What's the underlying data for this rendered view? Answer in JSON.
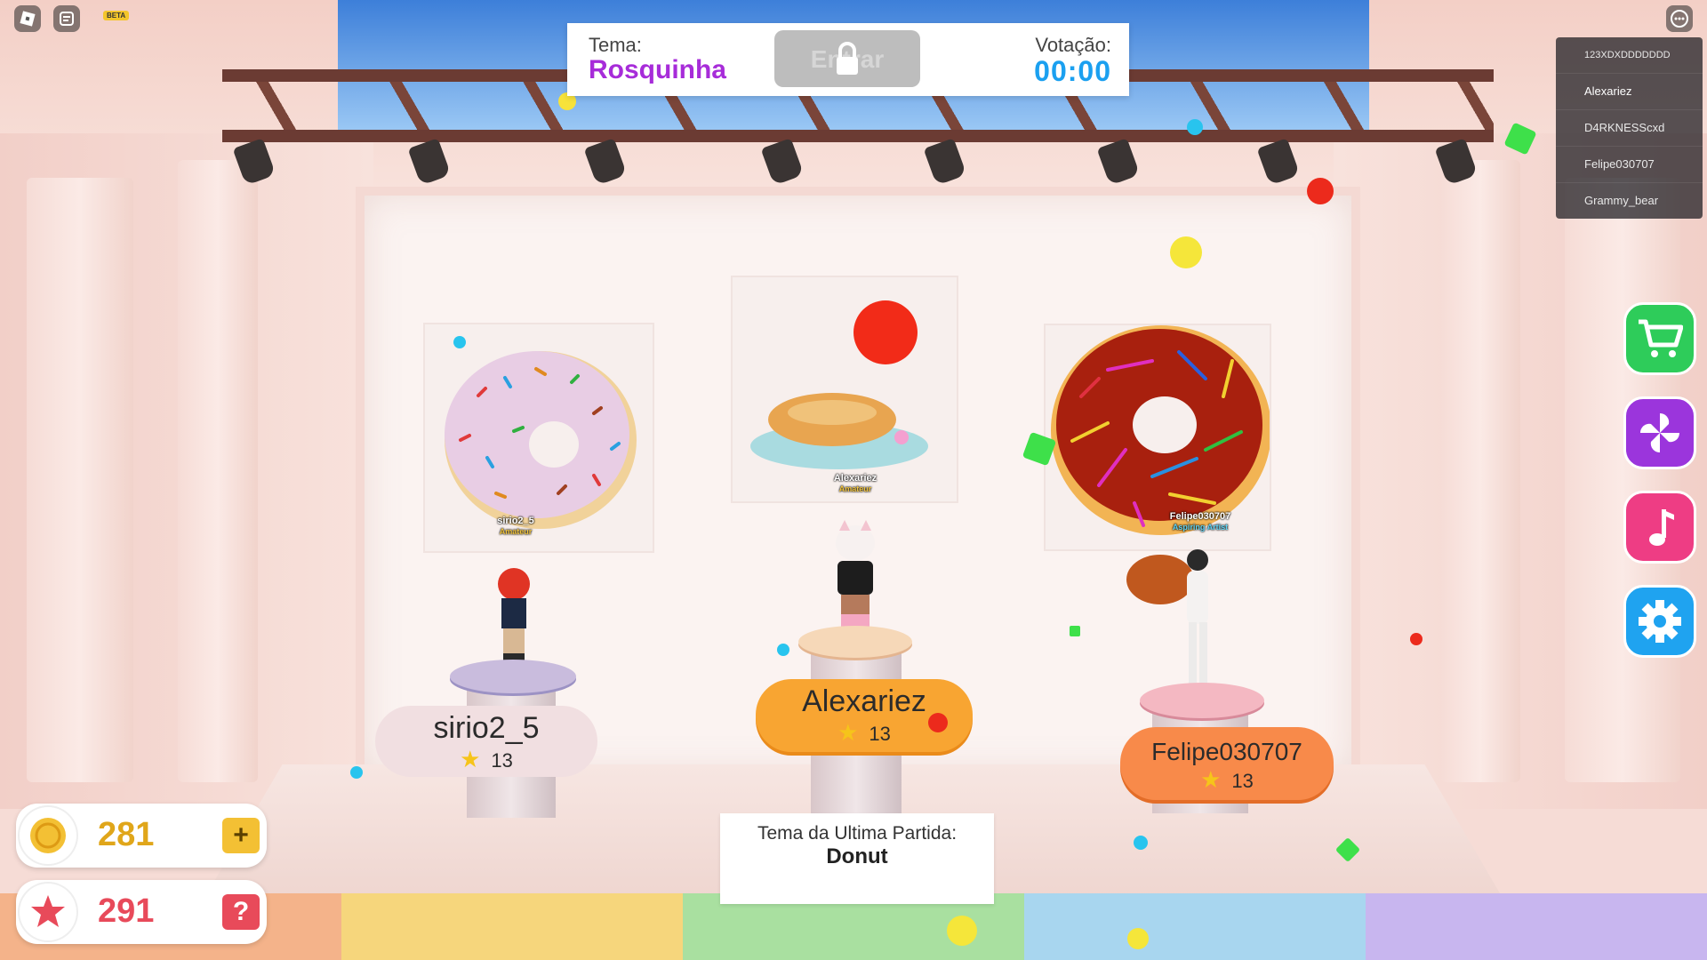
{
  "topbar": {
    "beta_label": "BETA"
  },
  "theme_panel": {
    "theme_label": "Tema:",
    "theme_value": "Rosquinha",
    "vote_label": "Votação:",
    "vote_time": "00:00",
    "enter_label": "Entrar"
  },
  "player_list": [
    "123XDXDDDDDDD",
    "Alexariez",
    "D4RKNESScxd",
    "Felipe030707",
    "Grammy_bear"
  ],
  "podiums": [
    {
      "name": "sirio2_5",
      "score": "13",
      "tag_name": "sirio2_5",
      "tag_rank": "Amateur"
    },
    {
      "name": "Alexariez",
      "score": "13",
      "tag_name": "Alexariez",
      "tag_rank": "Amateur"
    },
    {
      "name": "Felipe030707",
      "score": "13",
      "tag_name": "Felipe030707",
      "tag_rank": "Aspiring Artist"
    }
  ],
  "last_theme": {
    "label": "Tema da Ultima Partida:",
    "value": "Donut"
  },
  "currency": {
    "coins": "281",
    "coins_button": "+",
    "stars": "291",
    "stars_button": "?"
  },
  "side_buttons": [
    "shop",
    "spin",
    "music",
    "settings"
  ],
  "colors": {
    "theme": "#a72cd9",
    "timer": "#1ba0f0",
    "coin": "#e0a61a",
    "star": "#e84a5a"
  }
}
